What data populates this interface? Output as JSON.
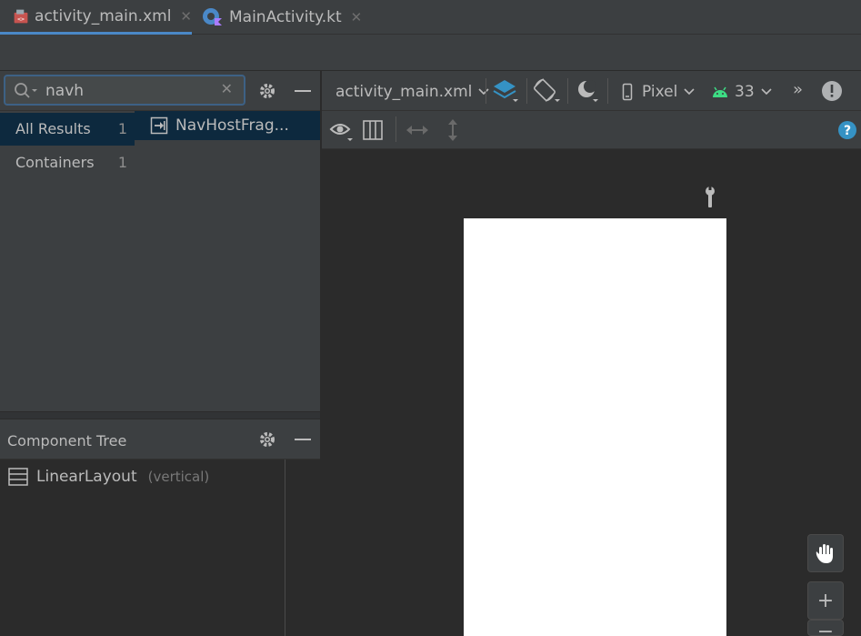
{
  "tabs": [
    {
      "label": "activity_main.xml",
      "close": "✕"
    },
    {
      "label": "MainActivity.kt",
      "close": "✕"
    }
  ],
  "palette": {
    "search": {
      "value": "navh",
      "clear": "✕"
    },
    "categories": [
      {
        "label": "All Results",
        "count": "1"
      },
      {
        "label": "Containers",
        "count": "1"
      }
    ],
    "results": [
      {
        "label": "NavHostFrag..."
      }
    ]
  },
  "component_tree": {
    "title": "Component Tree",
    "items": [
      {
        "label": "LinearLayout",
        "detail": "(vertical)"
      }
    ]
  },
  "design_toolbar": {
    "file": "activity_main.xml",
    "device": "Pixel",
    "api": "33",
    "more": "»"
  },
  "zoom": {
    "in": "+",
    "out": "−"
  },
  "colors": {
    "accent": "#4a88c7",
    "android_green": "#3ddc84",
    "selection": "#0d293e"
  }
}
